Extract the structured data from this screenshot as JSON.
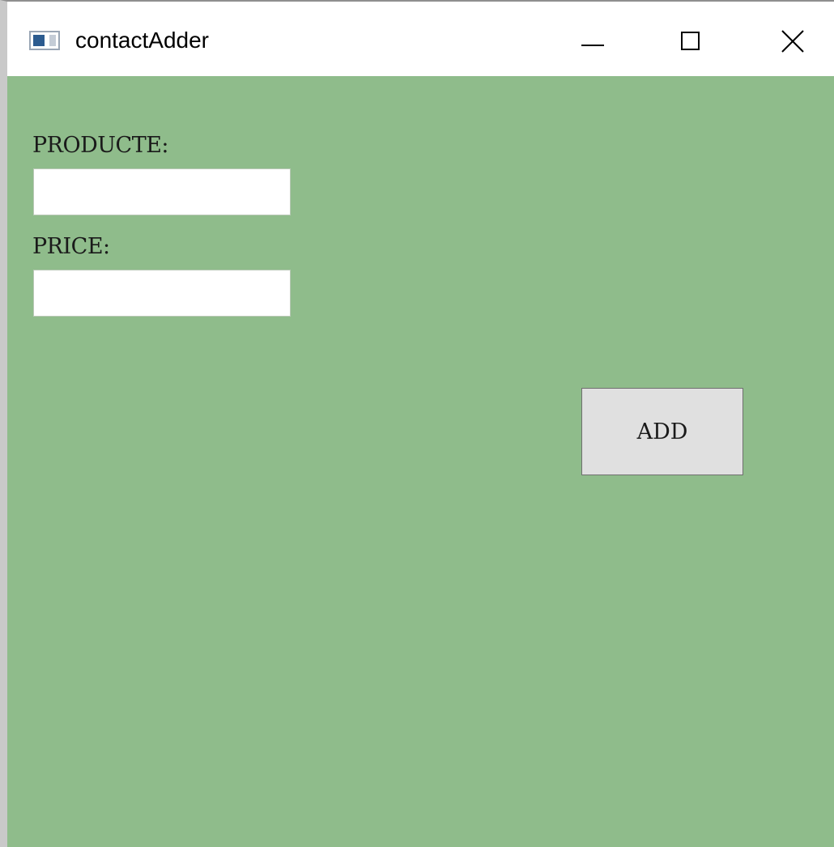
{
  "window": {
    "title": "contactAdder",
    "icon": "app-window-icon",
    "controls": {
      "minimize_icon": "minimize-icon",
      "maximize_icon": "maximize-icon",
      "close_icon": "close-icon"
    }
  },
  "form": {
    "product_label": "PRODUCTE:",
    "product_value": "",
    "price_label": "PRICE:",
    "price_value": "",
    "add_button_label": "ADD"
  },
  "colors": {
    "client_background": "#8fbc8b",
    "button_face": "#e0e0e0",
    "titlebar": "#ffffff"
  }
}
